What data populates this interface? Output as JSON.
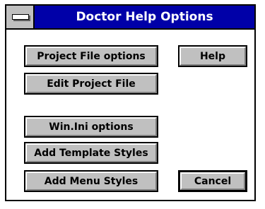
{
  "window": {
    "title": "Doctor Help Options"
  },
  "buttons": {
    "project_file_options": "Project File options",
    "help": "Help",
    "edit_project_file": "Edit Project File",
    "winini_options": "Win.Ini options",
    "add_template_styles": "Add Template Styles",
    "add_menu_styles": "Add Menu Styles",
    "cancel": "Cancel"
  },
  "icons": {
    "system_menu": "system-menu-icon"
  },
  "colors": {
    "titlebar": "#0000a8",
    "button_face": "#c0c0c0"
  }
}
